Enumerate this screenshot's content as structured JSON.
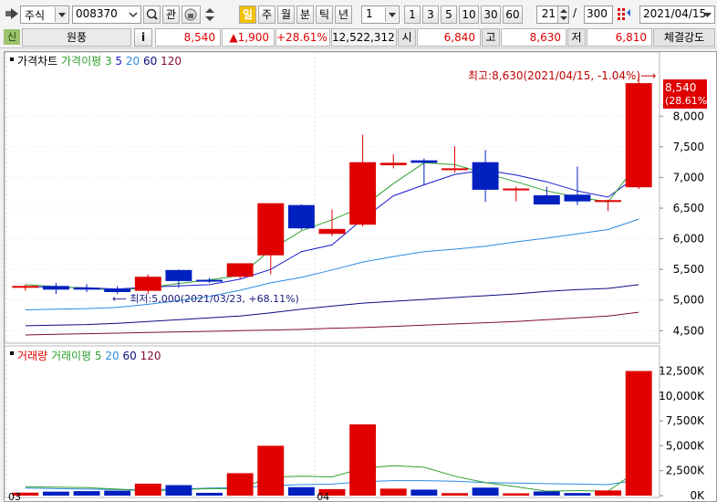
{
  "toolbar": {
    "market_select": "주식",
    "code_input": "008370",
    "search_icon": "magnifier-icon",
    "favorite_button": "관",
    "lock_icon": "lock-icon",
    "period_tabs": [
      "일",
      "주",
      "월",
      "분",
      "틱",
      "년"
    ],
    "period_active": "일",
    "interval_select": "1",
    "interval_buttons": [
      "1",
      "3",
      "5",
      "10",
      "30",
      "60"
    ],
    "candle_count": "21",
    "separator": "/",
    "total_count": "300",
    "date_select": "2021/04/15"
  },
  "quote_bar": {
    "badge": "신",
    "stock_name": "원풍",
    "info_button": "i",
    "price": "8,540",
    "change": "▲1,900",
    "change_rate": "+28.61%",
    "volume": "12,522,312",
    "open_label": "시",
    "open_value": "6,840",
    "high_label": "고",
    "high_value": "8,630",
    "low_label": "저",
    "low_value": "6,810",
    "strength_label": "체결강도"
  },
  "colors": {
    "up": "#e00000",
    "down": "#0020c0",
    "ma3": "#2ea02e",
    "ma5": "#1a1ad0",
    "ma20": "#2a8ae0",
    "ma60": "#0c0c80",
    "ma120": "#801030"
  },
  "price_panel": {
    "legend": [
      {
        "text": "가격차트",
        "color": "#000000"
      },
      {
        "text": "가격이평 3",
        "color": "#2ea02e"
      },
      {
        "text": "5",
        "color": "#1a1ad0"
      },
      {
        "text": "20",
        "color": "#2a8ae0"
      },
      {
        "text": "60",
        "color": "#0c0c80"
      },
      {
        "text": "120",
        "color": "#801030"
      }
    ],
    "high_annotation": "최고:8,630(2021/04/15, -1.04%)⟶",
    "low_annotation": "⟵ 최저:5,000(2021/03/23, +68.11%)",
    "last_price_tag": "8,540",
    "last_rate_tag": "(28.61%)",
    "y_ticks": [
      8000,
      7500,
      7000,
      6500,
      6000,
      5500,
      5000,
      4500
    ],
    "y_tick_labels": [
      "8,000",
      "7,500",
      "7,000",
      "6,500",
      "6,000",
      "5,500",
      "5,000",
      "4,500"
    ]
  },
  "volume_panel": {
    "legend": [
      {
        "text": "거래량",
        "color": "#e00000"
      },
      {
        "text": "거래이평 5",
        "color": "#2ea02e"
      },
      {
        "text": "20",
        "color": "#2a8ae0"
      },
      {
        "text": "60",
        "color": "#0c0c80"
      },
      {
        "text": "120",
        "color": "#801030"
      }
    ],
    "y_ticks": [
      12500,
      10000,
      7500,
      5000,
      2500,
      0
    ],
    "y_tick_labels": [
      "12,500K",
      "10,000K",
      "7,500K",
      "5,000K",
      "2,500K",
      "0K"
    ],
    "x_labels": [
      "03",
      "04"
    ]
  },
  "chart_data": {
    "type": "candlestick",
    "candles": [
      {
        "open": 5200,
        "high": 5250,
        "low": 5150,
        "close": 5230,
        "volume": 300
      },
      {
        "open": 5230,
        "high": 5280,
        "low": 5100,
        "close": 5170,
        "volume": 400
      },
      {
        "open": 5200,
        "high": 5260,
        "low": 5130,
        "close": 5170,
        "volume": 450
      },
      {
        "open": 5180,
        "high": 5230,
        "low": 5100,
        "close": 5130,
        "volume": 500
      },
      {
        "open": 5150,
        "high": 5420,
        "low": 5100,
        "close": 5380,
        "volume": 1200
      },
      {
        "open": 5490,
        "high": 5500,
        "low": 5200,
        "close": 5310,
        "volume": 1050
      },
      {
        "open": 5330,
        "high": 5360,
        "low": 5280,
        "close": 5300,
        "volume": 280
      },
      {
        "open": 5380,
        "high": 5560,
        "low": 5350,
        "close": 5600,
        "volume": 2250
      },
      {
        "open": 5730,
        "high": 6480,
        "low": 5420,
        "close": 6580,
        "volume": 5000
      },
      {
        "open": 6550,
        "high": 6560,
        "low": 6150,
        "close": 6170,
        "volume": 850
      },
      {
        "open": 6080,
        "high": 6480,
        "low": 6040,
        "close": 6160,
        "volume": 650
      },
      {
        "open": 6230,
        "high": 7700,
        "low": 6200,
        "close": 7250,
        "volume": 7150
      },
      {
        "open": 7200,
        "high": 7380,
        "low": 7150,
        "close": 7240,
        "volume": 700
      },
      {
        "open": 7280,
        "high": 7310,
        "low": 6870,
        "close": 7240,
        "volume": 600
      },
      {
        "open": 7150,
        "high": 7510,
        "low": 7080,
        "close": 7150,
        "volume": 250
      },
      {
        "open": 7250,
        "high": 7450,
        "low": 6600,
        "close": 6800,
        "volume": 800
      },
      {
        "open": 6800,
        "high": 6850,
        "low": 6610,
        "close": 6820,
        "volume": 230
      },
      {
        "open": 6710,
        "high": 6850,
        "low": 6560,
        "close": 6560,
        "volume": 420
      },
      {
        "open": 6720,
        "high": 7180,
        "low": 6550,
        "close": 6610,
        "volume": 260
      },
      {
        "open": 6620,
        "high": 6640,
        "low": 6450,
        "close": 6630,
        "volume": 520
      },
      {
        "open": 6840,
        "high": 8630,
        "low": 6810,
        "close": 8540,
        "volume": 12500
      }
    ],
    "ma3": [
      5250,
      5220,
      5190,
      5160,
      5200,
      5270,
      5330,
      5400,
      5820,
      6130,
      6310,
      6520,
      6900,
      7240,
      7210,
      7070,
      6930,
      6780,
      6680,
      6600,
      7250
    ],
    "ma5": [
      5220,
      5210,
      5200,
      5180,
      5210,
      5230,
      5250,
      5340,
      5500,
      5790,
      5900,
      6320,
      6700,
      6880,
      7050,
      7120,
      7040,
      6930,
      6780,
      6680,
      7040
    ],
    "ma20": [
      4840,
      4850,
      4860,
      4880,
      4930,
      4990,
      5060,
      5160,
      5280,
      5370,
      5490,
      5620,
      5710,
      5790,
      5830,
      5880,
      5950,
      6010,
      6080,
      6150,
      6320
    ],
    "ma60": [
      4580,
      4590,
      4600,
      4620,
      4650,
      4680,
      4710,
      4740,
      4790,
      4850,
      4900,
      4950,
      4980,
      5010,
      5040,
      5070,
      5100,
      5140,
      5170,
      5190,
      5250
    ],
    "ma120": [
      4430,
      4440,
      4450,
      4460,
      4470,
      4480,
      4490,
      4500,
      4510,
      4520,
      4540,
      4550,
      4570,
      4590,
      4610,
      4630,
      4650,
      4680,
      4710,
      4740,
      4800
    ],
    "vma5": [
      900,
      850,
      800,
      650,
      450,
      600,
      700,
      700,
      1850,
      1950,
      1880,
      2750,
      3000,
      2850,
      1950,
      1300,
      900,
      450,
      500,
      450,
      2600
    ],
    "vma20": [
      750,
      700,
      650,
      600,
      600,
      650,
      750,
      800,
      1000,
      1100,
      1150,
      1400,
      1500,
      1500,
      1450,
      1300,
      1250,
      1200,
      1150,
      1100,
      1600
    ],
    "price_ylim": [
      4400,
      8750
    ],
    "volume_ylim": [
      0,
      13000
    ]
  }
}
